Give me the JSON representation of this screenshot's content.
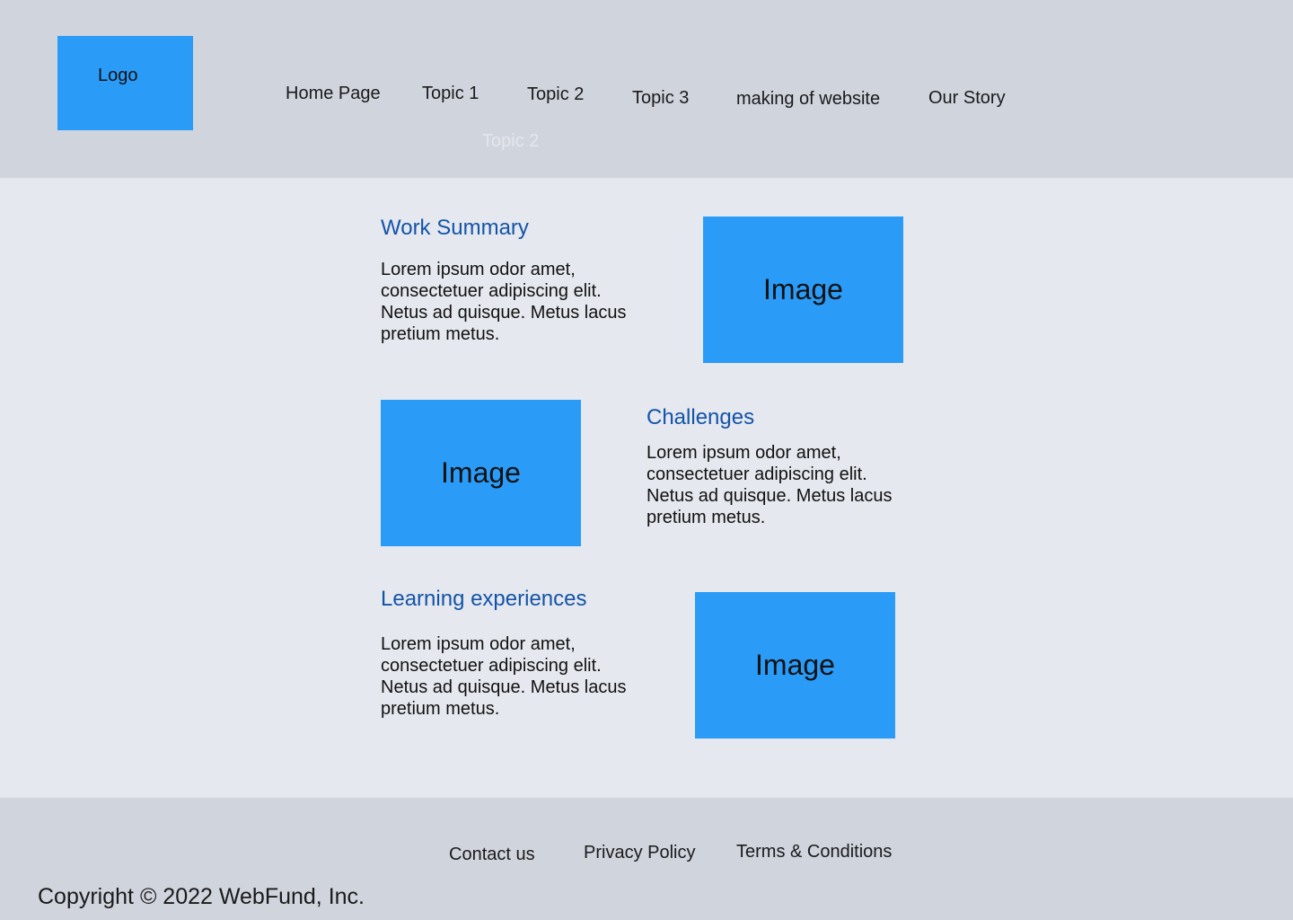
{
  "header": {
    "logo_label": "Logo",
    "nav": [
      {
        "label": "Home Page"
      },
      {
        "label": "Topic 1"
      },
      {
        "label": "Topic 2"
      },
      {
        "label": "Topic 3"
      },
      {
        "label": "making of website"
      },
      {
        "label": "Our Story"
      }
    ],
    "ghost_item": "Topic 2"
  },
  "sections": [
    {
      "title": "Work Summary",
      "body": "Lorem ipsum odor amet, consectetuer adipiscing elit. Netus ad quisque. Metus lacus pretium metus.",
      "image_label": "Image"
    },
    {
      "title": "Challenges",
      "body": "Lorem ipsum odor amet, consectetuer adipiscing elit. Netus ad quisque. Metus lacus pretium metus.",
      "image_label": "Image"
    },
    {
      "title": "Learning experiences",
      "body": "Lorem ipsum odor amet, consectetuer adipiscing elit. Netus ad quisque. Metus lacus pretium metus.",
      "image_label": "Image"
    }
  ],
  "footer": {
    "links": [
      {
        "label": "Contact us"
      },
      {
        "label": "Privacy Policy"
      },
      {
        "label": "Terms & Conditions"
      }
    ],
    "copyright": "Copyright © 2022 WebFund, Inc."
  },
  "colors": {
    "header_bg": "#d0d4dd",
    "main_bg": "#e5e8ee",
    "accent_blue": "#2a9cf8",
    "title_blue": "#1454a8"
  }
}
